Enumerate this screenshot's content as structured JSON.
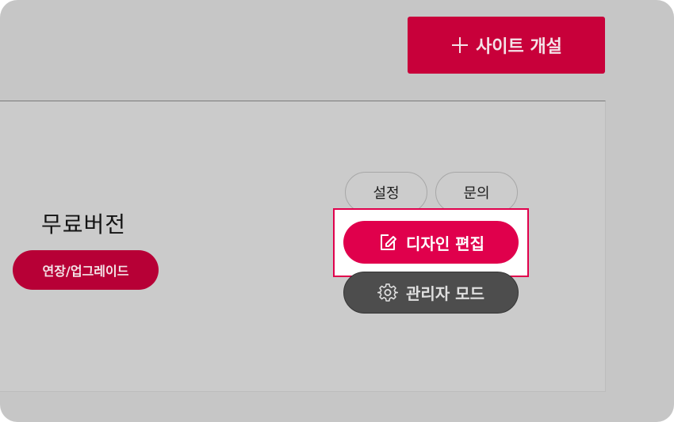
{
  "header": {
    "create_site_label": "사이트 개설",
    "create_icon": "plus-icon"
  },
  "plan": {
    "name": "무료버전",
    "upgrade_label": "연장/업그레이드"
  },
  "actions": {
    "settings_label": "설정",
    "inquiry_label": "문의",
    "design_edit_label": "디자인 편집",
    "design_edit_icon": "edit-icon",
    "admin_mode_label": "관리자 모드",
    "admin_mode_icon": "gear-icon"
  },
  "colors": {
    "brand_red": "#c8003a",
    "highlight_red": "#e0004c",
    "admin_dark": "#4d4d4d",
    "backdrop_gray": "#c6c6c6"
  }
}
